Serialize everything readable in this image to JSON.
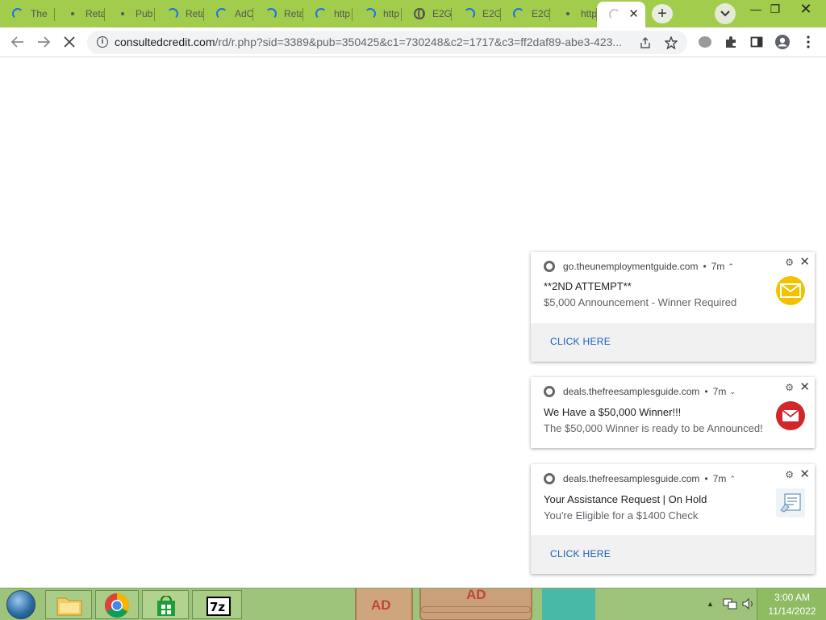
{
  "browser": {
    "tabs": [
      {
        "title": "The",
        "icon": "loading-spinner"
      },
      {
        "title": "Reta",
        "icon": "loading-dot"
      },
      {
        "title": "Pub",
        "icon": "loading-dot"
      },
      {
        "title": "Reta",
        "icon": "loading-spinner"
      },
      {
        "title": "AdC",
        "icon": "loading-spinner"
      },
      {
        "title": "Reta",
        "icon": "loading-spinner"
      },
      {
        "title": "http",
        "icon": "loading-spinner"
      },
      {
        "title": "http",
        "icon": "loading-spinner"
      },
      {
        "title": "E2G",
        "icon": "globe"
      },
      {
        "title": "E2G",
        "icon": "loading-spinner"
      },
      {
        "title": "E2G",
        "icon": "loading-spinner"
      },
      {
        "title": "http",
        "icon": "loading-dot"
      },
      {
        "title": "",
        "icon": "loading-spinner",
        "active": true
      }
    ],
    "url_domain": "consultedcredit.com",
    "url_path": "/rd/r.php?sid=3389&pub=350425&c1=730248&c2=1717&c3=ff2daf89-abe3-423..."
  },
  "notifications": [
    {
      "source": "go.theunemploymentguide.com",
      "age": "7m",
      "title": "**2ND ATTEMPT**",
      "body": "$5,000 Announcement - Winner Required",
      "icon": "envelope-icon",
      "icon_color": "#f2c200",
      "action": "CLICK HERE"
    },
    {
      "source": "deals.thefreesamplesguide.com",
      "age": "7m",
      "title": "We Have a $50,000 Winner!!!",
      "body": "The $50,000 Winner is ready to be Announced!",
      "icon": "mail-icon",
      "icon_color": "#d3262a"
    },
    {
      "source": "deals.thefreesamplesguide.com",
      "age": "7m",
      "title": "Your Assistance Request | On Hold",
      "body": "You're Eligible for a $1400 Check",
      "icon": "check-document-icon",
      "action": "CLICK HERE"
    }
  ],
  "taskbar": {
    "time": "3:00 AM",
    "date": "11/14/2022",
    "pinned_labels": [
      "AD",
      "AD"
    ]
  },
  "colors": {
    "tabstrip": "#a2cc4c",
    "taskbar": "#9dc47a",
    "link": "#1a5fb4"
  }
}
